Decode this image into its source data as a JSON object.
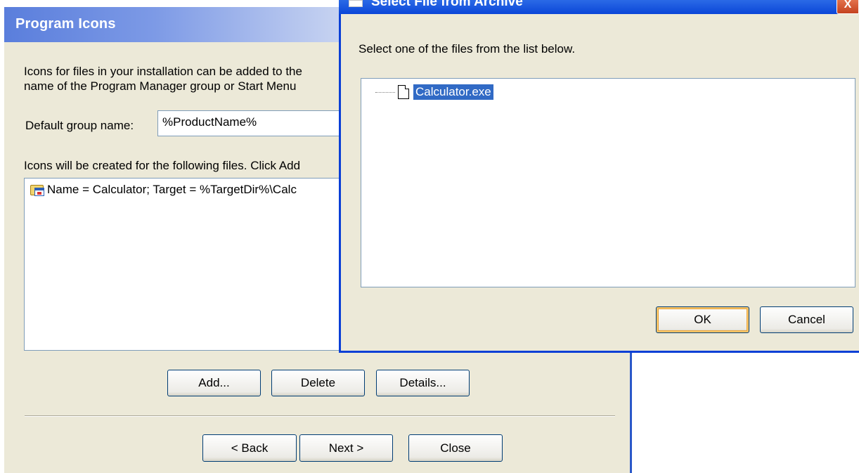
{
  "wizard": {
    "header_title": "Program Icons",
    "intro_line1": "Icons for files in your installation can be added to the",
    "intro_line2": "name of the Program Manager group or Start Menu",
    "default_group_label": "Default group name:",
    "default_group_value": "%ProductName%",
    "icons_instruction": "Icons will be created for the following files. Click Add",
    "icon_entries": [
      "Name = Calculator; Target = %TargetDir%\\Calc"
    ],
    "buttons": {
      "add": "Add...",
      "delete": "Delete",
      "details": "Details...",
      "back": "< Back",
      "next": "Next >",
      "close": "Close"
    }
  },
  "dialog": {
    "title": "Select File from Archive",
    "instruction": "Select one of the files from the list below.",
    "files": [
      "Calculator.exe"
    ],
    "selected_file": "Calculator.exe",
    "ok_label": "OK",
    "cancel_label": "Cancel",
    "close_glyph": "X"
  },
  "icons": {
    "shortcut": "shortcut-folder-icon",
    "file": "document-icon",
    "close": "close-icon"
  }
}
